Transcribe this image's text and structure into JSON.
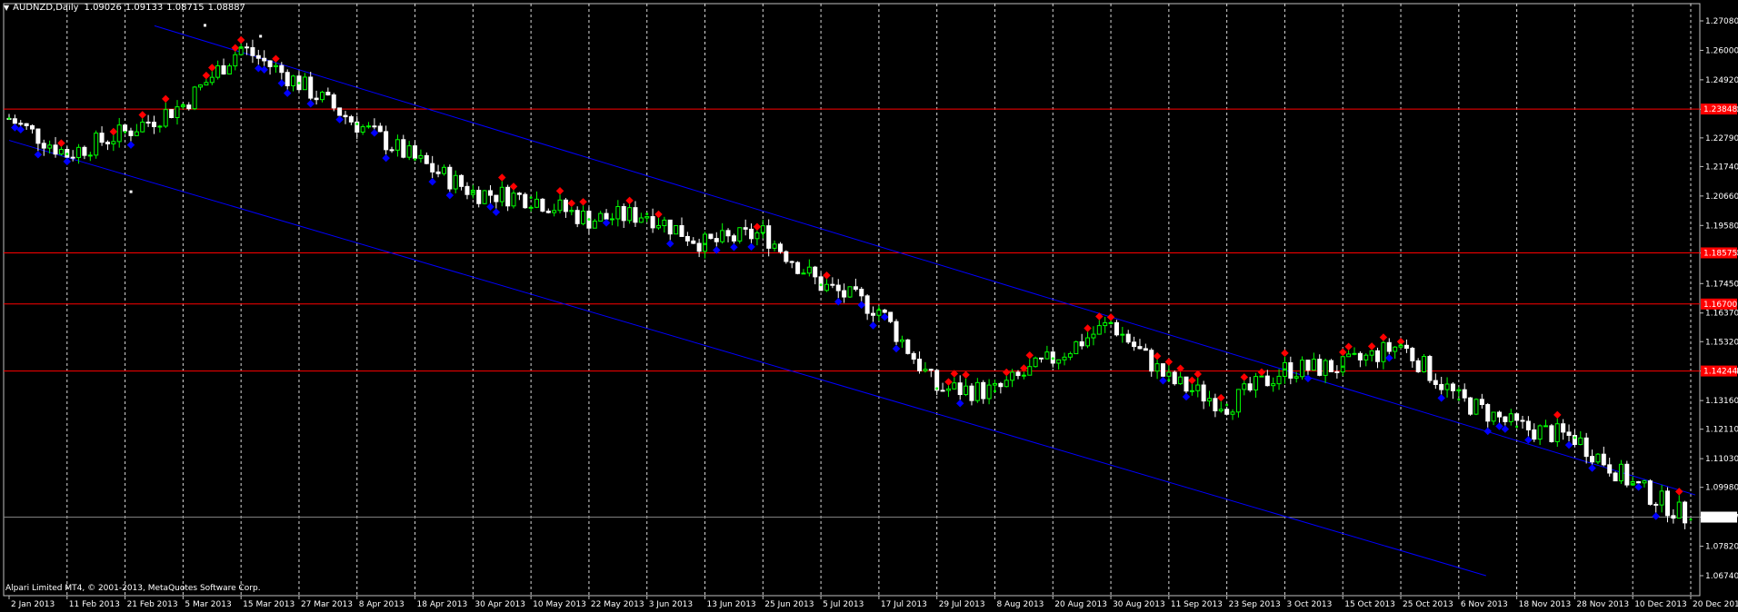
{
  "header": {
    "symbol_timeframe": "AUDNZD,Daily",
    "open": "1.09026",
    "high": "1.09133",
    "low": "1.08715",
    "close": "1.08887"
  },
  "copyright": "Alpari Limited MT4, © 2001-2013, MetaQuotes Software Corp.",
  "price_axis": {
    "ticks": [
      "1.27080",
      "1.26000",
      "1.24920",
      "1.23840",
      "1.22790",
      "1.21740",
      "1.20660",
      "1.19580",
      "1.18570",
      "1.17450",
      "1.16370",
      "1.15320",
      "1.14244",
      "1.13160",
      "1.12110",
      "1.11030",
      "1.09980",
      "1.08887",
      "1.07820",
      "1.06740"
    ],
    "levels": [
      {
        "label": "1.23848",
        "value": 1.23848,
        "bg": "#ff0000",
        "fg": "#000000"
      },
      {
        "label": "1.18575",
        "value": 1.18575,
        "bg": "#ff0000",
        "fg": "#000000"
      },
      {
        "label": "1.16700",
        "value": 1.167,
        "bg": "#ff0000",
        "fg": "#000000"
      },
      {
        "label": "1.14244",
        "value": 1.14244,
        "bg": "#ff0000",
        "fg": "#000000"
      },
      {
        "label": "1.08887",
        "value": 1.08887,
        "bg": "#ffffff",
        "fg": "#000000"
      }
    ]
  },
  "time_axis": {
    "ticks": [
      "2 Jan 2013",
      "11 Feb 2013",
      "21 Feb 2013",
      "5 Mar 2013",
      "15 Mar 2013",
      "27 Mar 2013",
      "8 Apr 2013",
      "18 Apr 2013",
      "30 Apr 2013",
      "10 May 2013",
      "22 May 2013",
      "3 Jun 2013",
      "13 Jun 2013",
      "25 Jun 2013",
      "5 Jul 2013",
      "17 Jul 2013",
      "29 Jul 2013",
      "8 Aug 2013",
      "20 Aug 2013",
      "30 Aug 2013",
      "11 Sep 2013",
      "23 Sep 2013",
      "3 Oct 2013",
      "15 Oct 2013",
      "25 Oct 2013",
      "6 Nov 2013",
      "18 Nov 2013",
      "28 Nov 2013",
      "10 Dec 2013",
      "20 Dec 2013"
    ]
  },
  "chart_data": {
    "type": "line",
    "title": "AUDNZD,Daily",
    "xlabel": "",
    "ylabel": "",
    "x": [
      "2 Jan 2013",
      "11 Feb 2013",
      "21 Feb 2013",
      "5 Mar 2013",
      "15 Mar 2013",
      "27 Mar 2013",
      "8 Apr 2013",
      "18 Apr 2013",
      "30 Apr 2013",
      "10 May 2013",
      "22 May 2013",
      "3 Jun 2013",
      "13 Jun 2013",
      "25 Jun 2013",
      "5 Jul 2013",
      "17 Jul 2013",
      "29 Jul 2013",
      "8 Aug 2013",
      "20 Aug 2013",
      "30 Aug 2013",
      "11 Sep 2013",
      "23 Sep 2013",
      "3 Oct 2013",
      "15 Oct 2013",
      "25 Oct 2013",
      "6 Nov 2013",
      "18 Nov 2013",
      "28 Nov 2013",
      "10 Dec 2013",
      "20 Dec 2013"
    ],
    "series": [
      {
        "values": [
          1.235,
          1.222,
          1.23,
          1.24,
          1.261,
          1.248,
          1.233,
          1.22,
          1.208,
          1.206,
          1.198,
          1.2,
          1.189,
          1.193,
          1.174,
          1.165,
          1.136,
          1.135,
          1.147,
          1.16,
          1.139,
          1.13,
          1.143,
          1.144,
          1.152,
          1.132,
          1.122,
          1.118,
          1.101,
          1.088
        ]
      }
    ],
    "ylim": [
      1.0674,
      1.2708
    ],
    "grid": true,
    "colors": {
      "background": "#000000",
      "grid": "#ffffff",
      "bull_candle": "#00ff00",
      "bear_candle": "#ffffff",
      "channel": "#0000ff",
      "level": "#ff0000",
      "up_marker": "#ff0000",
      "down_marker": "#0000ff"
    }
  }
}
